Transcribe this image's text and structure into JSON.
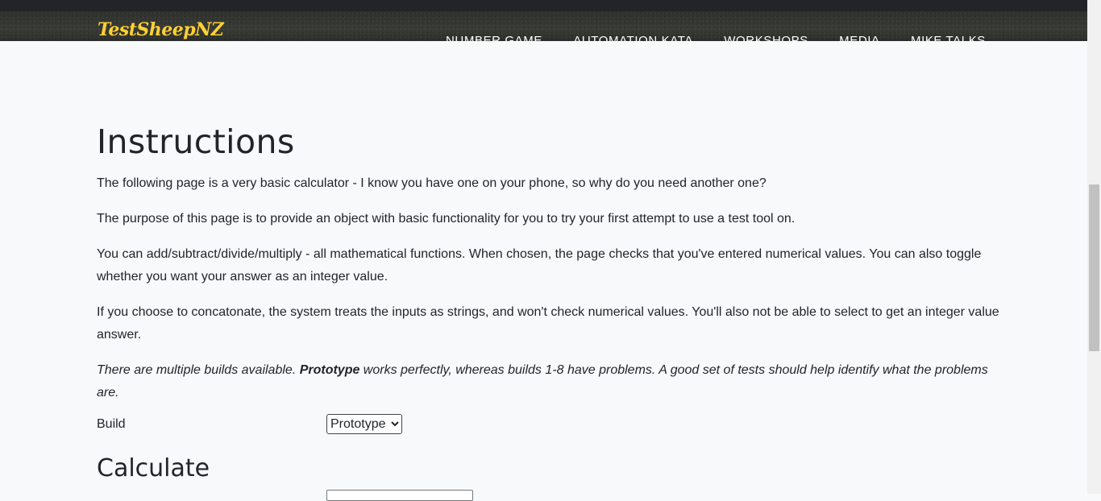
{
  "header": {
    "brand": "TestSheepNZ",
    "nav": [
      "NUMBER GAME",
      "AUTOMATION KATA",
      "WORKSHOPS",
      "MEDIA",
      "MIKE TALKS"
    ]
  },
  "main": {
    "title": "Instructions",
    "paragraph1": "The following page is a very basic calculator - I know you have one on your phone, so why do you need another one?",
    "paragraph2": "The purpose of this page is to provide an object with basic functionality for you to try your first attempt to use a test tool on.",
    "paragraph3": "You can add/subtract/divide/multiply - all mathematical functions. When chosen, the page checks that you've entered numerical values. You can also toggle whether you want your answer as an integer value.",
    "paragraph4": "If you choose to concatonate, the system treats the inputs as strings, and won't check numerical values. You'll also not be able to select to get an integer value answer.",
    "note": {
      "part1": "There are multiple builds available. ",
      "bold": "Prototype",
      "part2": " works perfectly, whereas builds 1-8 have problems. A good set of tests should help identify what the problems are."
    },
    "build": {
      "label": "Build",
      "selected": "Prototype"
    },
    "calculate_title": "Calculate"
  },
  "colors": {
    "brand": "#fed136",
    "background": "#f8f9fb",
    "text": "#212529"
  }
}
